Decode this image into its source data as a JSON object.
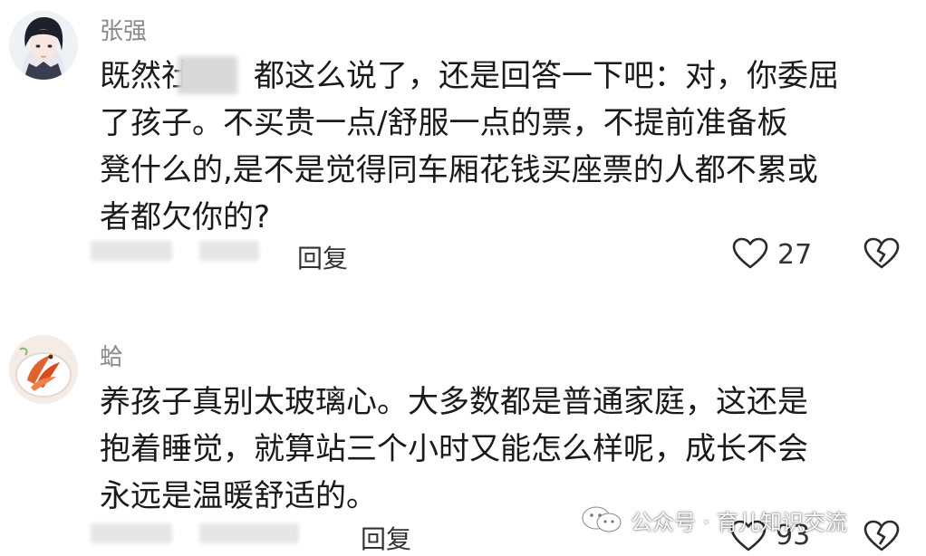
{
  "comments": [
    {
      "username": "张强",
      "lines": [
        "既然社　　都这么说了，还是回答一下吧：对，你委屈",
        "了孩子。不买贵一点/舒服一点的票，不提前准备板",
        "凳什么的,是不是觉得同车厢花钱买座票的人都不累或",
        "者都欠你的?"
      ],
      "reply_label": "回复",
      "likes": "27",
      "avatar_icon": "anime-portrait-avatar"
    },
    {
      "username": "蛤",
      "lines": [
        "养孩子真别太玻璃心。大多数都是普通家庭，这还是",
        "抱着睡觉，就算站三个小时又能怎么样呢，成长不会",
        "永远是温暖舒适的。"
      ],
      "reply_label": "回复",
      "likes": "93",
      "avatar_icon": "food-plate-avatar"
    }
  ],
  "watermark": {
    "text": "公众号 · 育儿知识交流",
    "icon": "wechat-icon"
  },
  "colors": {
    "username": "#8a8a8a",
    "text": "#1a1a1a",
    "meta": "#333333"
  }
}
